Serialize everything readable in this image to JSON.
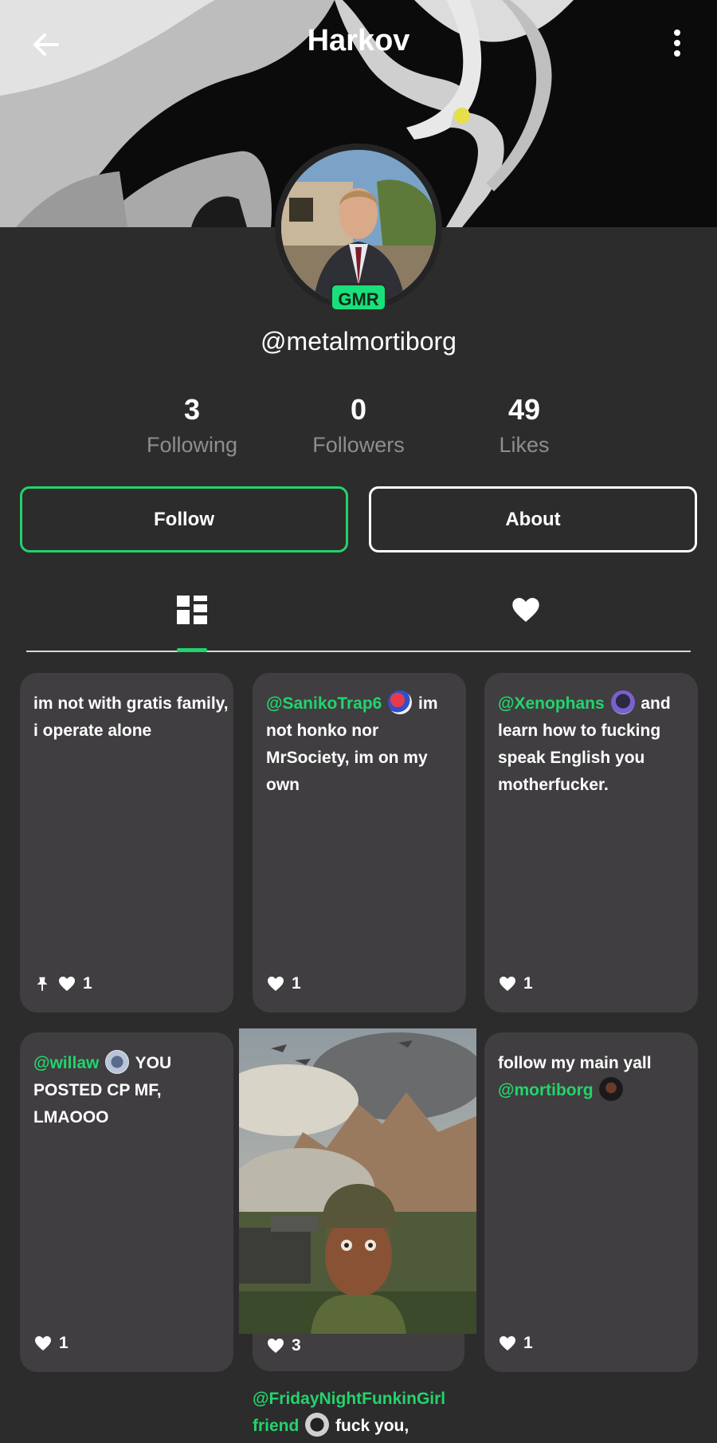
{
  "header": {
    "title": "Harkov",
    "back_icon": "arrow-left-icon",
    "menu_icon": "more-vertical-icon"
  },
  "profile": {
    "badge": "GMR",
    "username": "@metalmortiborg"
  },
  "stats": {
    "following": {
      "value": "3",
      "label": "Following"
    },
    "followers": {
      "value": "0",
      "label": "Followers"
    },
    "likes": {
      "value": "49",
      "label": "Likes"
    }
  },
  "actions": {
    "follow_label": "Follow",
    "about_label": "About"
  },
  "tabs": {
    "posts_icon": "grid-icon",
    "likes_icon": "heart-icon",
    "active": "posts"
  },
  "posts": [
    {
      "text": "im not with gratis family, i operate alone",
      "likes": "1",
      "pinned": true
    },
    {
      "mention": "@SanikoTrap6",
      "text": "im not honko nor MrSociety, im on my own",
      "likes": "1"
    },
    {
      "mention": "@Xenophans",
      "text": "and learn how to fucking speak English you motherfucker.",
      "likes": "1"
    },
    {
      "mention": "@willaw",
      "text": "YOU POSTED CP MF, LMAOOO",
      "likes": "1"
    },
    {
      "mention": "@FridayNightFunkinGirl",
      "text_a": "friend",
      "text_b": "fuck you,",
      "likes": "3"
    },
    {
      "text": "follow my main yall",
      "mention": "@mortiborg",
      "likes": "1"
    }
  ],
  "colors": {
    "accent": "#22d46c",
    "background": "#2d2c2d",
    "card": "#403e40",
    "muted": "#8e8d8f"
  }
}
